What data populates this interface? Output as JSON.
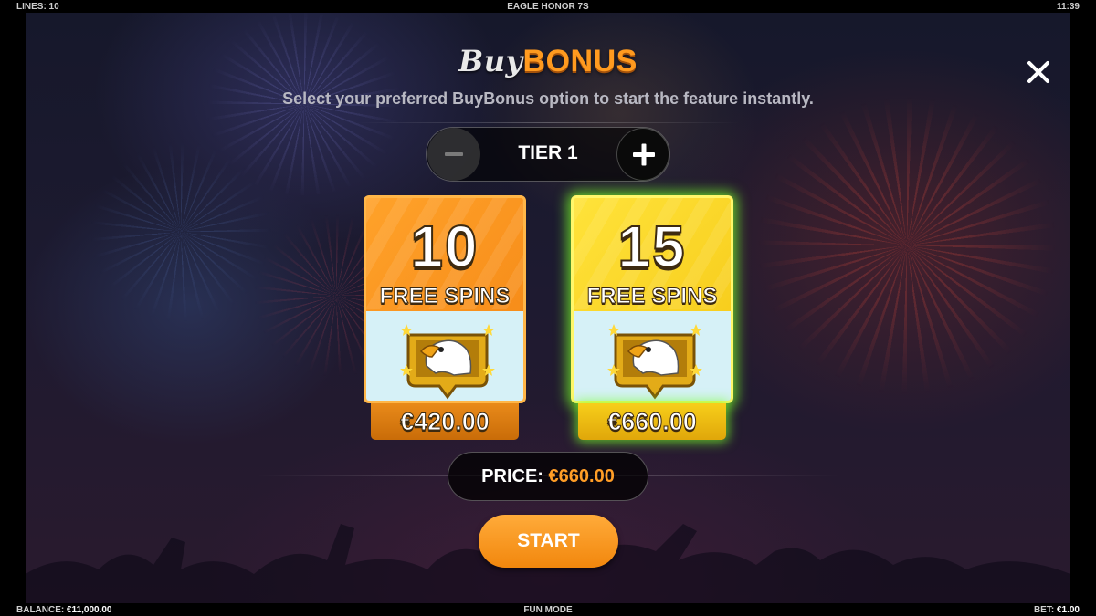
{
  "topbar": {
    "lines_label": "LINES: 10",
    "game_title": "EAGLE HONOR 7S",
    "time": "11:39"
  },
  "bottombar": {
    "balance_label": "BALANCE:",
    "balance_value": "€11,000.00",
    "mode": "FUN MODE",
    "bet_label": "BET:",
    "bet_value": "€1.00"
  },
  "header": {
    "title_buy": "Buy",
    "title_bonus": "BONUS",
    "subtitle": "Select your preferred BuyBonus option to start the feature instantly."
  },
  "tier": {
    "label": "TIER 1"
  },
  "options": [
    {
      "spins": "10",
      "label": "FREE SPINS",
      "price": "€420.00",
      "color": "#f48614",
      "selected": false
    },
    {
      "spins": "15",
      "label": "FREE SPINS",
      "price": "€660.00",
      "color": "#f5c714",
      "selected": true
    }
  ],
  "price": {
    "label": "PRICE:",
    "value": "€660.00"
  },
  "start": {
    "label": "START"
  },
  "colors": {
    "accent": "#ff9a1f",
    "selected_glow": "#78ff28",
    "panel_bg": "#1d1a30"
  },
  "icons": {
    "close": "close-icon",
    "minus": "minus-icon",
    "plus": "plus-icon",
    "eagle": "eagle-badge-icon"
  }
}
